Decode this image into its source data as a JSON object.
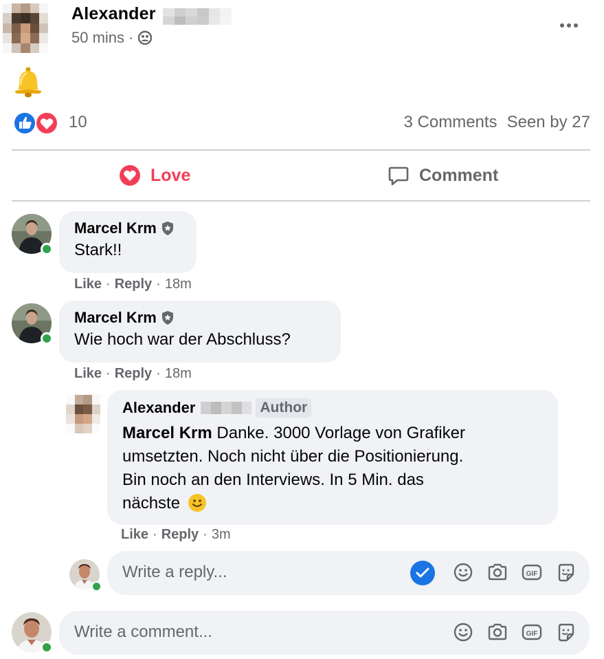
{
  "post": {
    "author_name": "Alexander",
    "time": "50 mins",
    "time_separator": "·",
    "content_emoji": "bell",
    "reaction_count": "10",
    "comments_count": "3 Comments",
    "seen_by": "Seen by 27"
  },
  "actions": {
    "love_label": "Love",
    "comment_label": "Comment"
  },
  "comments": [
    {
      "name": "Marcel Krm",
      "text": "Stark!!",
      "like": "Like",
      "reply": "Reply",
      "sep": "·",
      "time": "18m"
    },
    {
      "name": "Marcel Krm",
      "text": "Wie hoch war der Abschluss?",
      "like": "Like",
      "reply": "Reply",
      "sep": "·",
      "time": "18m"
    }
  ],
  "reply": {
    "name": "Alexander",
    "badge": "Author",
    "mention": "Marcel Krm",
    "text_1": "Danke. 3000 Vorlage von Grafiker",
    "text_2": "umsetzten. Noch nicht über die Positionierung.",
    "text_3": "Bin noch an den Interviews. In 5 Min. das",
    "text_4": "nächste",
    "like": "Like",
    "reply": "Reply",
    "sep": "·",
    "time": "3m"
  },
  "inputs": {
    "reply_placeholder": "Write a reply...",
    "comment_placeholder": "Write a comment..."
  },
  "colors": {
    "love": "#f33e58",
    "like_blue": "#1b74e4",
    "secondary_text": "#65676b",
    "bubble_bg": "#f0f2f5",
    "online": "#31a24c"
  }
}
